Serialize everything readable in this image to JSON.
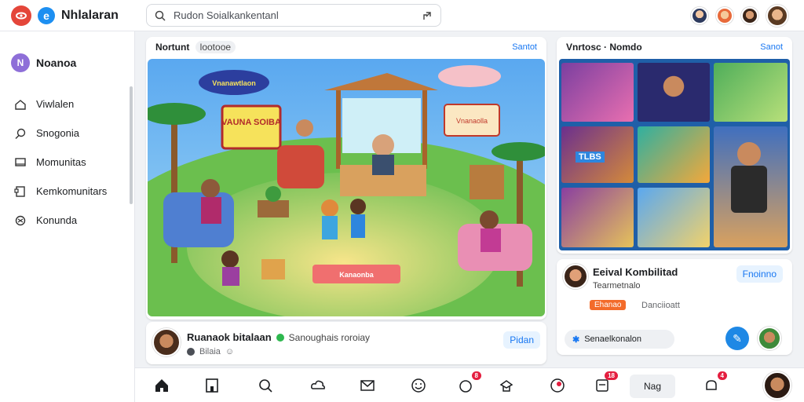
{
  "app": {
    "name": "Nhlalaran"
  },
  "search": {
    "placeholder": "Rudon Soialkankentanl"
  },
  "sidebar": {
    "profile": {
      "initial": "N",
      "name": "Noanoa"
    },
    "items": [
      {
        "label": "Viwlalen",
        "icon": "home-outline-icon"
      },
      {
        "label": "Snogonia",
        "icon": "search-icon"
      },
      {
        "label": "Momunitas",
        "icon": "monitor-icon"
      },
      {
        "label": "Kemkomunitars",
        "icon": "pages-icon"
      },
      {
        "label": "Konunda",
        "icon": "people-icon"
      }
    ]
  },
  "main_card": {
    "title": "Nortunt",
    "chip": "lootooe",
    "link": "Santot",
    "scene_labels": {
      "sign_left": "VAUNA SOIBA",
      "sign_top": "Vnanawtlaon",
      "sign_right": "Vnanaolla",
      "floor_sign": "Kanaonba"
    }
  },
  "post_bar": {
    "name": "Ruanaok bitalaan",
    "subtitle": "Sanoughais roroiay",
    "meta": "Bilaia",
    "button": "Pidan"
  },
  "right_card": {
    "title": "Vnrtosc · Nomdo",
    "link": "Sanot",
    "tile_text": "TLBS"
  },
  "profile_card": {
    "name": "Eeival Kombilitad",
    "role": "Tearmetnalo",
    "tag": "Ehanao",
    "tag_note": "Danciioatt",
    "button": "Fnoinno",
    "input_label": "Senaelkonalon"
  },
  "bottom_nav": {
    "label": "Nag",
    "badges": {
      "notif": "8",
      "chat": "18",
      "alerts": "4"
    }
  },
  "colors": {
    "accent": "#1877f2",
    "brand_red": "#e4463a",
    "badge": "#e41e3f"
  }
}
